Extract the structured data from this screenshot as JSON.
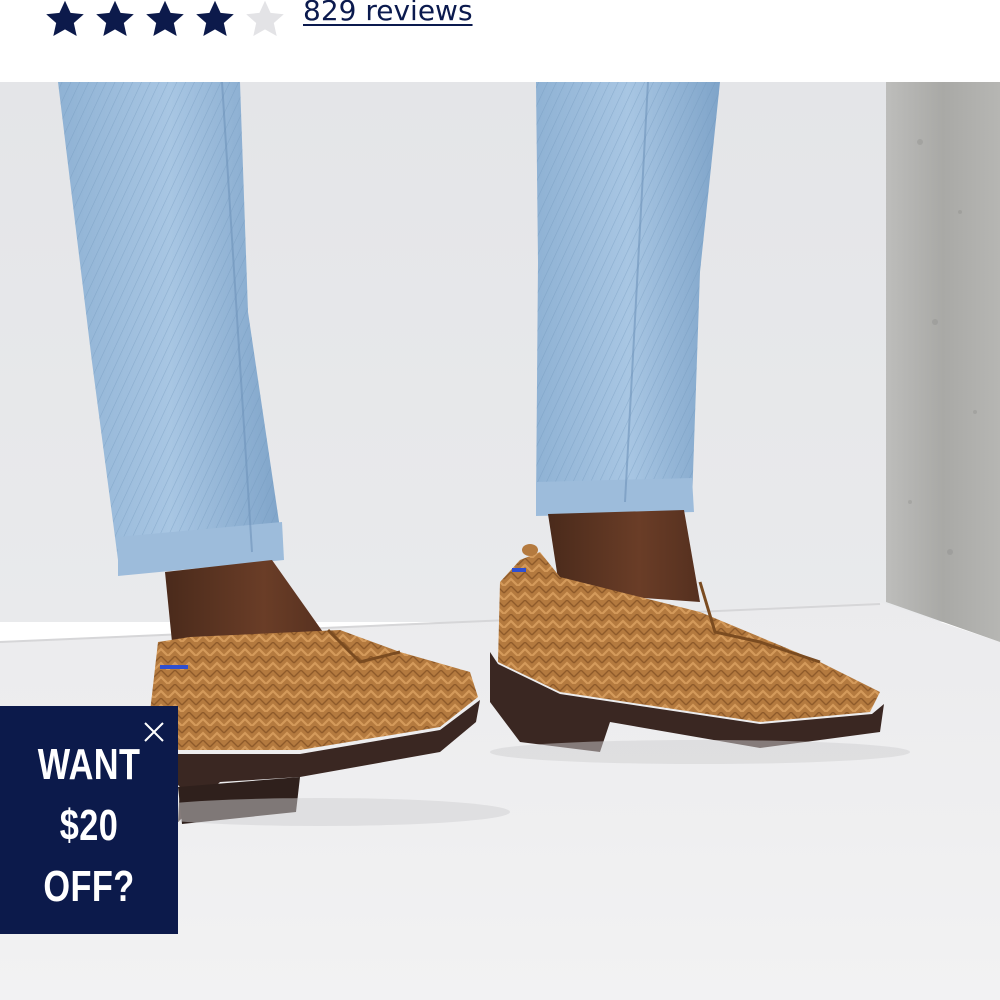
{
  "rating": {
    "value": 4,
    "max": 5,
    "filled_color": "#0c1a4b",
    "empty_color": "#e3e3e6",
    "icon": "star-icon"
  },
  "reviews": {
    "label": "829 reviews"
  },
  "hero": {
    "image": "model wearing light-wash jeans and brown herringbone knit loafers on white floor"
  },
  "promo": {
    "lines": [
      "WANT",
      "$20",
      "OFF?"
    ],
    "background": "#0c1a4b",
    "close_icon": "close-icon"
  }
}
